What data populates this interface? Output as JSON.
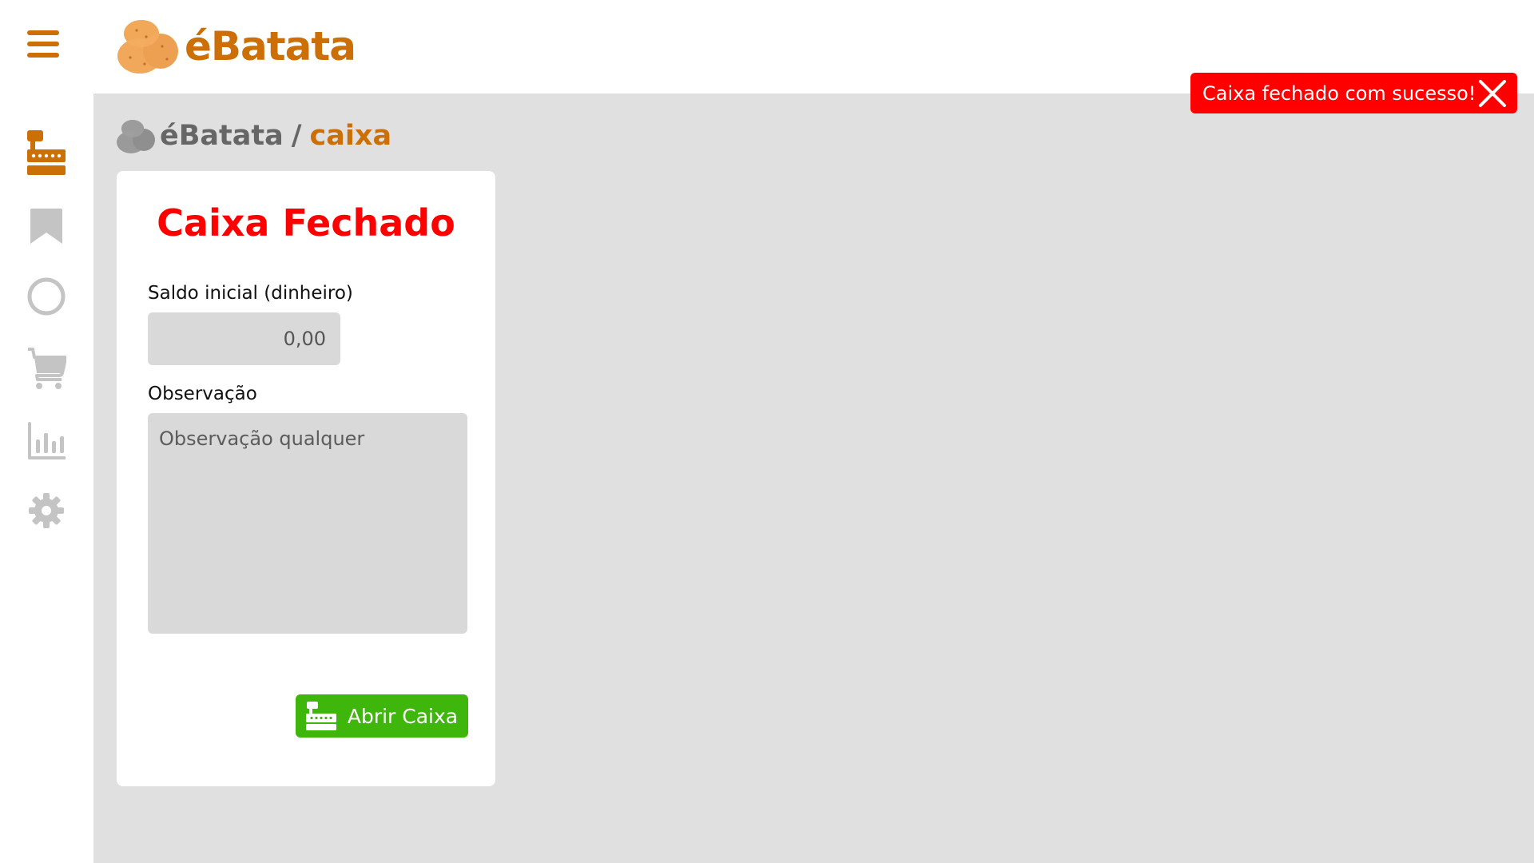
{
  "app": {
    "brand_name": "éBatata",
    "brand_color": "#cc6f06"
  },
  "header": {
    "menu_icon": "hamburger-menu-icon"
  },
  "sidebar": {
    "items": [
      {
        "name": "cash-register-icon",
        "active": true
      },
      {
        "name": "bookmark-icon",
        "active": false
      },
      {
        "name": "circle-icon",
        "active": false
      },
      {
        "name": "shopping-cart-icon",
        "active": false
      },
      {
        "name": "bar-chart-icon",
        "active": false
      },
      {
        "name": "settings-gear-icon",
        "active": false
      }
    ],
    "active_color": "#cc6f06",
    "inactive_color": "#c4c4c4"
  },
  "breadcrumb": {
    "home": "éBatata",
    "separator": "/",
    "current": "caixa"
  },
  "card": {
    "title": "Caixa Fechado",
    "title_color": "#ff0000",
    "saldo_label": "Saldo inicial (dinheiro)",
    "saldo_placeholder": "0,00",
    "obs_label": "Observação",
    "obs_placeholder": "Observação qualquer",
    "open_button_label": "Abrir Caixa",
    "open_button_color": "#3fb60c"
  },
  "toast": {
    "message": "Caixa fechado com sucesso!",
    "color": "#ff0000"
  }
}
